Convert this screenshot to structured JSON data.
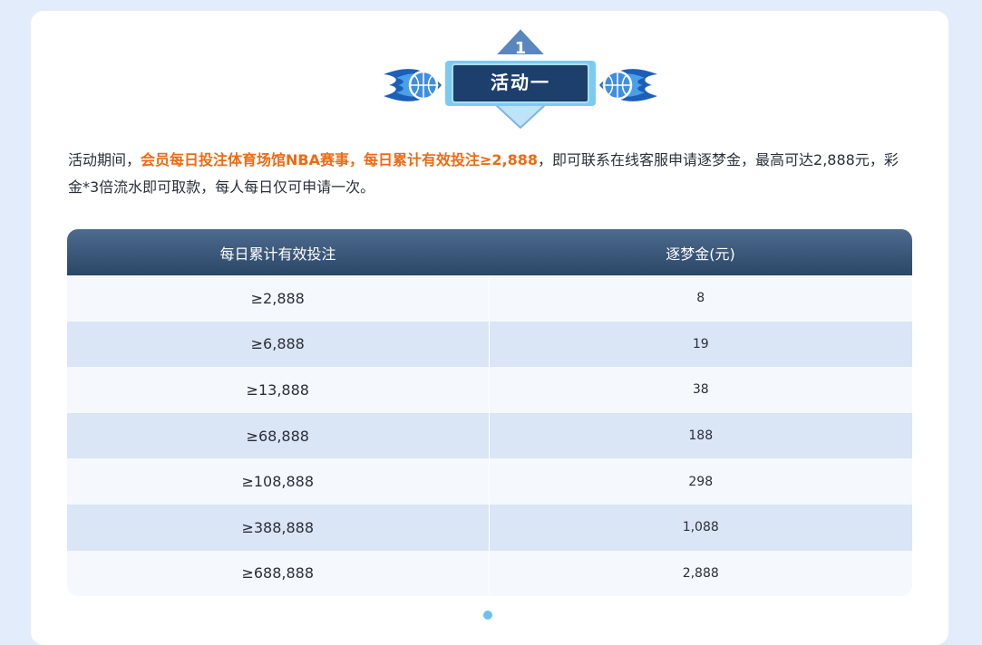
{
  "badge": {
    "number": "1",
    "title": "活动一"
  },
  "description": {
    "part1": "活动期间，",
    "highlight1": "会员每日投注体育场馆NBA赛事，每日累计有效投注≥2,888",
    "part2": "，即可联系在线客服申请逐梦金，最高可达2,888元，彩金*3倍流水即可取款，每人每日仅可申请一次。"
  },
  "table": {
    "headers": [
      "每日累计有效投注",
      "逐梦金(元)"
    ],
    "rows": [
      [
        "≥2,888",
        "8"
      ],
      [
        "≥6,888",
        "19"
      ],
      [
        "≥13,888",
        "38"
      ],
      [
        "≥68,888",
        "188"
      ],
      [
        "≥108,888",
        "298"
      ],
      [
        "≥388,888",
        "1,088"
      ],
      [
        "≥688,888",
        "2,888"
      ]
    ]
  },
  "colors": {
    "page_bg": "#e3ecfb",
    "highlight": "#ee6a12",
    "header_dark": "#2b4767",
    "row_alt": "#dae5f5",
    "badge_blue": "#3e6ea6",
    "flame_blue": "#1c5fb8"
  },
  "icons": [
    "left-flaming-basketball-icon",
    "right-flaming-basketball-icon"
  ]
}
